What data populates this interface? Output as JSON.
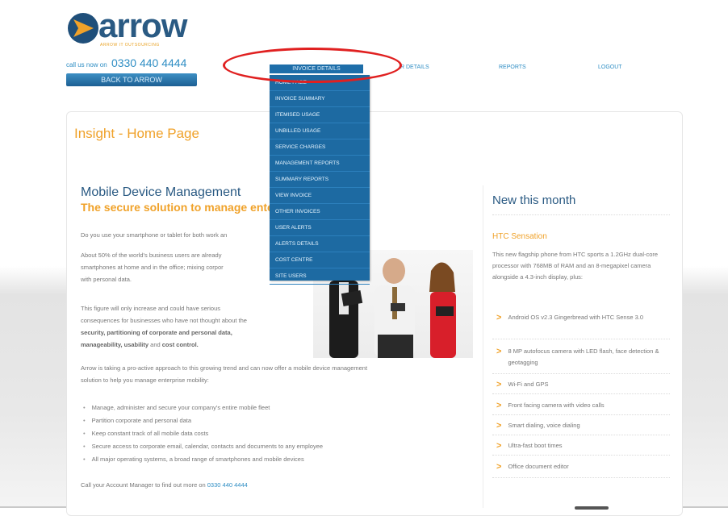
{
  "brand": {
    "name": "arrow",
    "tagline": "ARROW IT OUTSOURCING",
    "call_prefix": "call us now on",
    "phone": "0330 440 4444",
    "back_label": "BACK TO ARROW",
    "accent": "#f0a22a",
    "primary": "#2a5a83"
  },
  "nav": {
    "active": "INVOICE DETAILS",
    "partial": "R DETAILS",
    "reports": "REPORTS",
    "logout": "LOGOUT"
  },
  "dropdown": {
    "items": [
      "HOME PAGE",
      "INVOICE SUMMARY",
      "ITEMISED USAGE",
      "UNBILLED USAGE",
      "SERVICE CHARGES",
      "MANAGEMENT REPORTS",
      "SUMMARY REPORTS",
      "VIEW INVOICE",
      "OTHER INVOICES",
      "USER ALERTS",
      "ALERTS DETAILS",
      "COST CENTRE",
      "SITE USERS"
    ]
  },
  "main": {
    "page_title": "Insight - Home Page",
    "mdm_title": "Mobile Device Management",
    "mdm_subtitle": "The secure solution to manage enterpris",
    "p1": "Do you use your smartphone or tablet for both work an",
    "p2_line1": "About 50% of the world's business users are already",
    "p2_line2": "smartphones at home and in the office; mixing corpor",
    "p2_line3": "with personal data.",
    "p3_line1": "This figure will only increase and could have serious",
    "p3_line2": "consequences for businesses who have not thought about the",
    "p3_bold1": "security, partitioning of corporate and personal data,",
    "p3_bold2": "manageability, usability",
    "p3_and": "and",
    "p3_bold3": "cost control.",
    "p4_line1": "Arrow is taking a pro-active approach to this growing trend and can now offer a mobile device management",
    "p4_line2": "solution to help you manage enterprise mobility:",
    "bullets": [
      "Manage, administer and secure your company's entire mobile fleet",
      "Partition corporate and personal data",
      "Keep constant track of all mobile data costs",
      "Secure access to corporate email, calendar, contacts and documents to any employee",
      "All major operating systems, a broad range of smartphones and mobile devices"
    ],
    "call_text": "Call your Account Manager to find out more on",
    "call_number": "0330 440 4444"
  },
  "sidebar": {
    "title": "New this month",
    "product": "HTC Sensation",
    "desc": "This new flagship phone from HTC sports a 1.2GHz dual-core processor with 768MB of RAM and an 8-megapixel camera alongside a 4.3-inch display, plus:",
    "features": [
      "Android OS v2.3 Gingerbread with HTC Sense 3.0",
      "8 MP autofocus camera with LED flash, face detection & geotagging",
      "Wi-Fi and GPS",
      "Front facing camera with video calls",
      "Smart dialing, voice dialing",
      "Ultra-fast boot times",
      "Office document editor"
    ]
  }
}
